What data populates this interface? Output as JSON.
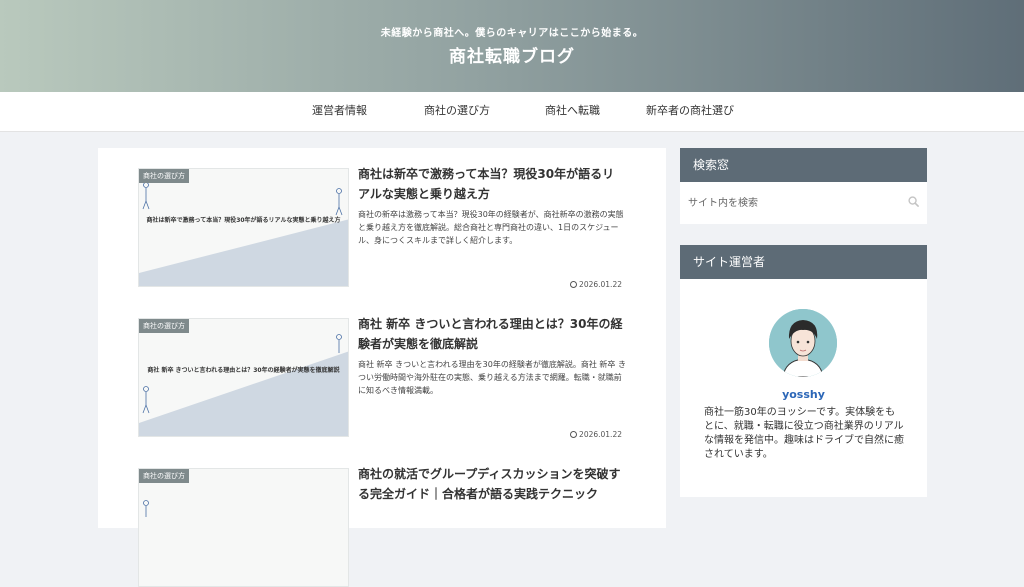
{
  "header": {
    "tagline": "未経験から商社へ。僕らのキャリアはここから始まる。",
    "site_title": "商社転職ブログ"
  },
  "nav": {
    "items": [
      "運営者情報",
      "商社の選び方",
      "商社へ転職",
      "新卒者の商社選び"
    ]
  },
  "posts": [
    {
      "category": "商社の選び方",
      "thumb_text": "商社は新卒で激務って本当？現役30年が語るリアルな実態と乗り越え方",
      "title": "商社は新卒で激務って本当？現役30年が語るリアルな実態と乗り越え方",
      "snippet": "商社の新卒は激務って本当？現役30年の経験者が、商社新卒の激務の実態と乗り越え方を徹底解説。総合商社と専門商社の違い、1日のスケジュール、身につくスキルまで詳しく紹介します。",
      "date": "2026.01.22"
    },
    {
      "category": "商社の選び方",
      "thumb_text": "商社 新卒 きついと言われる理由とは？30年の経験者が実態を徹底解説",
      "title": "商社 新卒 きついと言われる理由とは？30年の経験者が実態を徹底解説",
      "snippet": "商社 新卒 きついと言われる理由を30年の経験者が徹底解説。商社 新卒 きつい労働時間や海外駐在の実態、乗り越える方法まで網羅。転職・就職前に知るべき情報満載。",
      "date": "2026.01.22"
    },
    {
      "category": "商社の選び方",
      "thumb_text": "",
      "title": "商社の就活でグループディスカッションを突破する完全ガイド｜合格者が語る実践テクニック",
      "snippet": "",
      "date": ""
    }
  ],
  "search_widget": {
    "heading": "検索窓",
    "placeholder": "サイト内を検索"
  },
  "author_widget": {
    "heading": "サイト運営者",
    "name": "yosshy",
    "bio": "商社一筋30年のヨッシーです。実体験をもとに、就職・転職に役立つ商社業界のリアルな情報を発信中。趣味はドライブで自然に癒されています。"
  },
  "colors": {
    "header_gradient_start": "#b9c9bd",
    "header_gradient_end": "#5f6e78",
    "widget_heading_bg": "#5d6b76",
    "author_name": "#2b66b7",
    "avatar_bg": "#8fc6cc"
  }
}
